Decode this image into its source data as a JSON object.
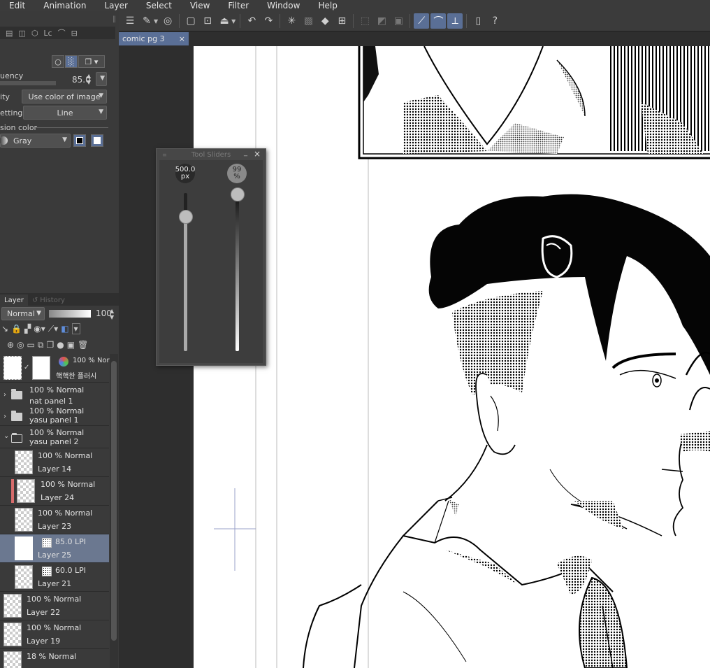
{
  "menu": [
    "Edit",
    "Animation",
    "Layer",
    "Select",
    "View",
    "Filter",
    "Window",
    "Help"
  ],
  "document_tab": {
    "title": "comic pg 3",
    "close": "×"
  },
  "tool_property": {
    "tab_partial": "Lc",
    "frequency_label": "uency",
    "frequency_value": "85.0",
    "density_label": "ity",
    "density_value": "Use color of image",
    "settings_label": "ettings",
    "settings_value": "Line",
    "expression_label": "sion color",
    "expression_value": "Gray"
  },
  "tool_sliders": {
    "title": "Tool Sliders",
    "size_value": "500.0",
    "size_unit": "px",
    "size_level": 0.85,
    "opacity_value": "99",
    "opacity_unit": "%",
    "opacity_level": 0.99
  },
  "layer_panel": {
    "tabs": [
      "Layer",
      "History"
    ],
    "blend_mode": "Normal",
    "opacity": "100",
    "layers": [
      {
        "line1": "100 % Nor",
        "line2": "핵핵한 플러시",
        "kind": "special"
      },
      {
        "line1": "100 % Normal",
        "line2": "nat panel 1",
        "kind": "folder",
        "fold": "›"
      },
      {
        "line1": "100 % Normal",
        "line2": "yasu panel 1",
        "kind": "folder",
        "fold": "›"
      },
      {
        "line1": "100 % Normal",
        "line2": "yasu panel 2",
        "kind": "folder-open",
        "fold": "⌄"
      },
      {
        "line1": "100 % Normal",
        "line2": "Layer 14",
        "kind": "child"
      },
      {
        "line1": "100 % Normal",
        "line2": "Layer 24",
        "kind": "child-marked"
      },
      {
        "line1": "100 % Normal",
        "line2": "Layer 23",
        "kind": "child"
      },
      {
        "line1": "85.0 LPI",
        "line2": "Layer 25",
        "kind": "child-tone-selected"
      },
      {
        "line1": "60.0 LPI",
        "line2": "Layer 21",
        "kind": "child-tone"
      },
      {
        "line1": "100 % Normal",
        "line2": "Layer 22",
        "kind": "plain"
      },
      {
        "line1": "100 % Normal",
        "line2": "Layer 19",
        "kind": "plain"
      },
      {
        "line1": "18 % Normal",
        "line2": "",
        "kind": "plain"
      }
    ]
  },
  "colors": {
    "accent": "#5a6f96",
    "panel": "#3a3a3a",
    "selected_layer": "#6b7890",
    "marker": "#d76c6c"
  },
  "icons": [
    "menu-icon",
    "pen-icon",
    "spiral-icon",
    "new-layer-icon",
    "fill-icon",
    "undo-icon",
    "redo-icon",
    "loading-icon",
    "transform-icon",
    "ruler-icon",
    "snap-icon",
    "help-icon"
  ]
}
